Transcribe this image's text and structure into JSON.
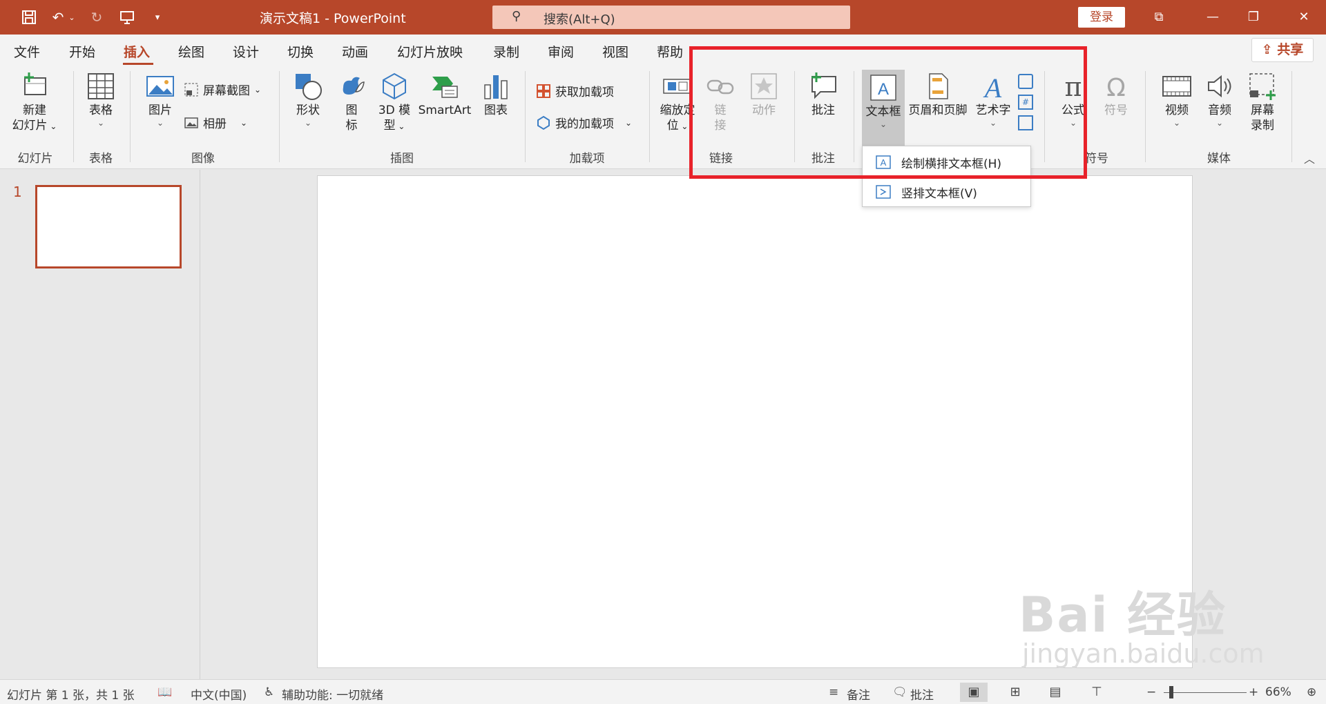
{
  "window": {
    "title": "演示文稿1  -  PowerPoint",
    "search_placeholder": "搜索(Alt+Q)",
    "login": "登录",
    "share": "共享"
  },
  "menu": {
    "tabs": [
      "文件",
      "开始",
      "插入",
      "绘图",
      "设计",
      "切换",
      "动画",
      "幻灯片放映",
      "录制",
      "审阅",
      "视图",
      "帮助"
    ],
    "active": "插入"
  },
  "ribbon": {
    "new_slide": "新建",
    "new_slide2": "幻灯片",
    "table": "表格",
    "picture": "图片",
    "screenshot": "屏幕截图",
    "album": "相册",
    "shapes": "形状",
    "icons1": "图",
    "icons2": "标",
    "model3d1": "3D 模",
    "model3d2": "型",
    "smartart": "SmartArt",
    "chart": "图表",
    "get_addins": "获取加载项",
    "my_addins": "我的加载项",
    "zoom1": "缩放定",
    "zoom2": "位",
    "link1": "链",
    "link2": "接",
    "action": "动作",
    "comment": "批注",
    "textbox": "文本框",
    "header_footer": "页眉和页脚",
    "wordart": "艺术字",
    "equation": "公式",
    "symbol": "符号",
    "video": "视频",
    "audio": "音频",
    "screen_rec1": "屏幕",
    "screen_rec2": "录制",
    "groups": {
      "slides": "幻灯片",
      "tables": "表格",
      "images": "图像",
      "illustrations": "插图",
      "addins": "加载项",
      "links": "链接",
      "comments": "批注",
      "symbols": "符号",
      "media": "媒体"
    }
  },
  "dropdown": {
    "items": [
      "绘制横排文本框(H)",
      "竖排文本框(V)"
    ]
  },
  "slides": {
    "number": "1"
  },
  "status": {
    "slide_info": "幻灯片 第 1 张，共 1 张",
    "language": "中文(中国)",
    "accessibility": "辅助功能: 一切就绪",
    "notes": "备注",
    "comments": "批注",
    "zoom": "66%"
  },
  "watermark": {
    "line1": "Bai 经验",
    "line2": "jingyan.baidu.com"
  },
  "colors": {
    "accent": "#b7472a",
    "highlight": "#e8222a"
  }
}
